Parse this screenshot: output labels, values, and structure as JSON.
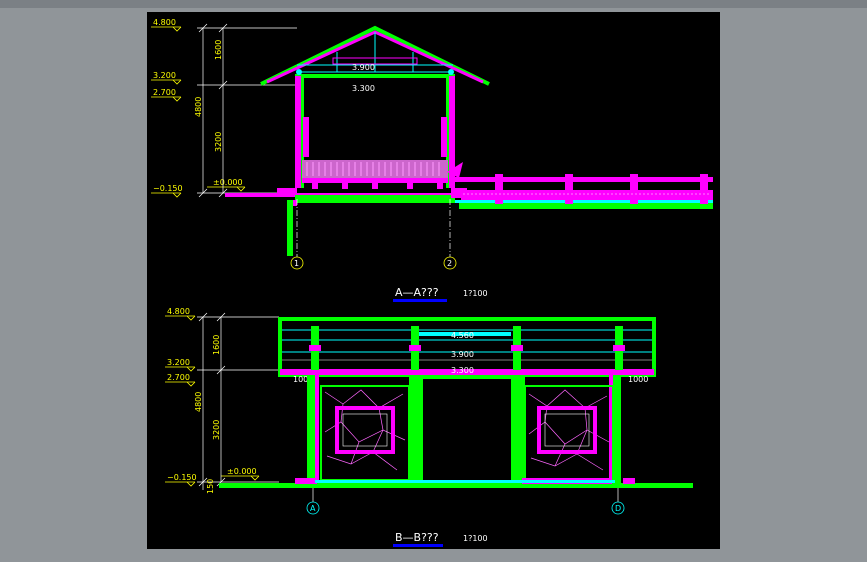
{
  "section_aa": {
    "title": "A—A???",
    "scale": "1?100",
    "levels": {
      "top": "4.800",
      "eave": "3.200",
      "beam": "2.700",
      "zero": "±0.000",
      "ground": "−0.150"
    },
    "dims": {
      "d1": "1600",
      "d2": "3200",
      "total": "4800"
    },
    "inner_levels": {
      "l1": "3.900",
      "l2": "3.300"
    },
    "axes": {
      "a1": "1",
      "a2": "2"
    }
  },
  "section_bb": {
    "title": "B—B???",
    "scale": "1?100",
    "levels": {
      "top": "4.800",
      "eave": "3.200",
      "beam": "2.700",
      "zero": "±0.000",
      "ground": "−0.150"
    },
    "dims": {
      "d1": "1600",
      "d2": "3200",
      "total": "4800",
      "base": "150",
      "left_off": "1000",
      "right_off": "1000"
    },
    "inner_levels": {
      "l1": "4.560",
      "l2": "3.900",
      "l3": "3.300"
    },
    "axes": {
      "a1": "A",
      "a2": "D"
    }
  },
  "colors": {
    "structure": "#00ff00",
    "accent": "#ff00ff",
    "annotation": "#ffff00",
    "detail": "#00ffff",
    "title_underline": "#0000ff",
    "background": "#000000"
  }
}
